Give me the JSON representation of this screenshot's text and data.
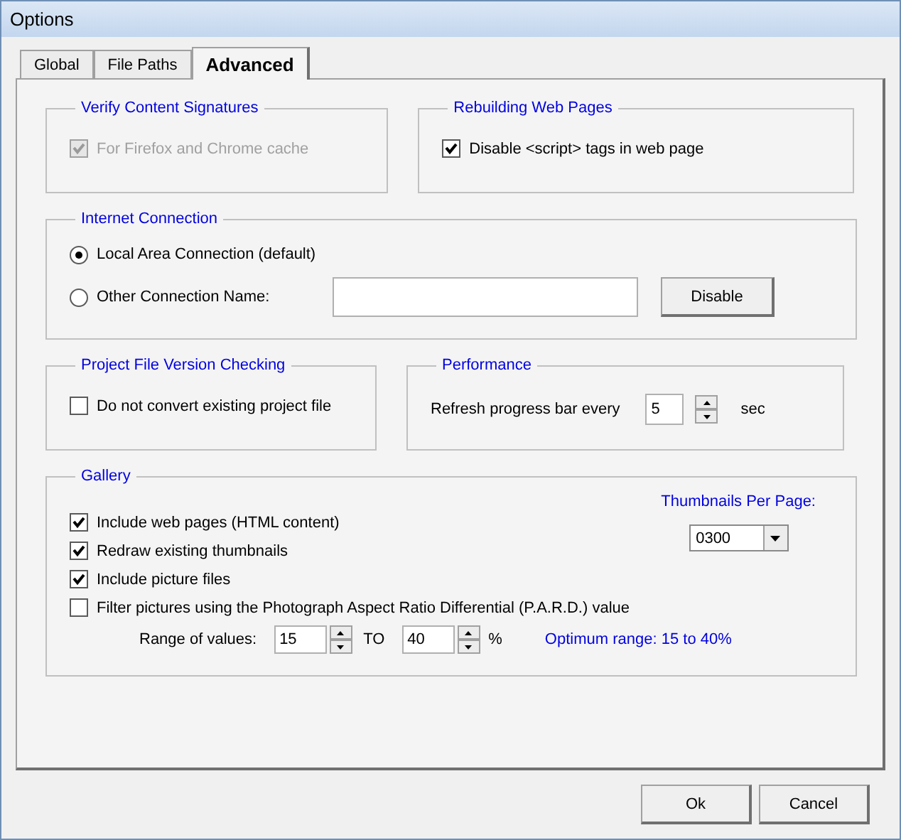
{
  "window": {
    "title": "Options"
  },
  "tabs": [
    {
      "label": "Global",
      "selected": false
    },
    {
      "label": "File Paths",
      "selected": false
    },
    {
      "label": "Advanced",
      "selected": true
    }
  ],
  "verify_content_signatures": {
    "title": "Verify Content Signatures",
    "checkbox": {
      "label": "For Firefox and Chrome cache",
      "checked": true,
      "disabled": true
    }
  },
  "rebuilding_web_pages": {
    "title": "Rebuilding Web Pages",
    "checkbox": {
      "label": "Disable <script> tags in web page",
      "checked": true,
      "disabled": false
    }
  },
  "internet_connection": {
    "title": "Internet Connection",
    "options": [
      {
        "label": "Local Area Connection (default)",
        "selected": true
      },
      {
        "label": "Other Connection Name:",
        "selected": false
      }
    ],
    "button": "Disable"
  },
  "project_file_version_checking": {
    "title": "Project File Version Checking",
    "checkbox": {
      "label": "Do not convert existing project file",
      "checked": false,
      "disabled": false
    }
  },
  "performance": {
    "title": "Performance",
    "label": "Refresh progress bar every",
    "value": "5",
    "unit": "sec"
  },
  "gallery": {
    "title": "Gallery",
    "checkboxes": [
      {
        "label": "Include web pages (HTML content)",
        "checked": true
      },
      {
        "label": "Redraw existing thumbnails",
        "checked": true
      },
      {
        "label": "Include picture files",
        "checked": true
      },
      {
        "label": "Filter pictures using the Photograph Aspect Ratio Differential (P.A.R.D.) value",
        "checked": false
      }
    ],
    "thumbnails_per_page": {
      "label": "Thumbnails Per Page:",
      "value": "0300"
    },
    "range": {
      "label": "Range of values:",
      "from": "15",
      "separator": "TO",
      "to": "40",
      "unit": "%",
      "hint": "Optimum range: 15 to 40%"
    }
  },
  "buttons": [
    "Ok",
    "Cancel"
  ]
}
